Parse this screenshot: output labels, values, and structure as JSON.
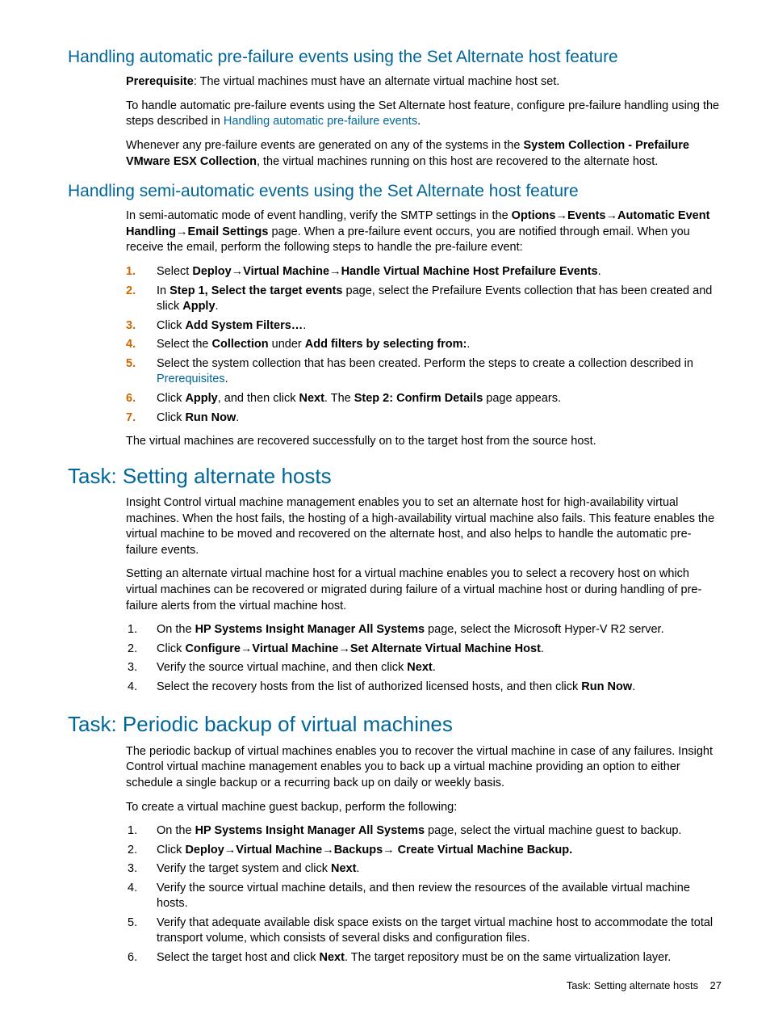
{
  "section1": {
    "heading": "Handling automatic pre-failure events using the Set Alternate host feature",
    "prereq_label": "Prerequisite",
    "prereq_text": ": The virtual machines must have an alternate virtual machine host set.",
    "p2a": "To handle automatic pre-failure events using the Set Alternate host feature, configure pre-failure handling using the steps described in ",
    "p2link": "Handling automatic pre-failure events",
    "p2b": ".",
    "p3a": "Whenever any pre-failure events are generated on any of the systems in the ",
    "p3bold": "System Collection - Prefailure VMware ESX Collection",
    "p3b": ", the virtual machines running on this host are recovered to the alternate host."
  },
  "section2": {
    "heading": "Handling semi-automatic events using the Set Alternate host feature",
    "p1a": "In semi-automatic mode of event handling, verify the SMTP settings in the ",
    "p1bold": "Options→Events→Automatic Event Handling→Email Settings",
    "p1b": " page. When a pre-failure event occurs, you are notified through email. When you receive the email, perform the following steps to handle the pre-failure event:",
    "li1a": "Select ",
    "li1bold": "Deploy→Virtual Machine→Handle Virtual Machine Host Prefailure Events",
    "li1b": ".",
    "li2a": "In ",
    "li2bold1": "Step 1, Select the target events",
    "li2b": " page, select the Prefailure Events collection that has been created and slick ",
    "li2bold2": "Apply",
    "li2c": ".",
    "li3a": "Click ",
    "li3bold": "Add System Filters…",
    "li3b": ".",
    "li4a": "Select the ",
    "li4bold1": "Collection",
    "li4b": " under ",
    "li4bold2": "Add filters by selecting from:",
    "li4c": ".",
    "li5a": "Select the system collection that has been created. Perform the steps to create a collection described in ",
    "li5link": "Prerequisites",
    "li5b": ".",
    "li6a": "Click ",
    "li6bold1": "Apply",
    "li6b": ", and then click ",
    "li6bold2": "Next",
    "li6c": ". The ",
    "li6bold3": "Step 2: Confirm Details",
    "li6d": " page appears.",
    "li7a": "Click ",
    "li7bold": "Run Now",
    "li7b": ".",
    "p_after": "The virtual machines are recovered successfully on to the target host from the source host."
  },
  "section3": {
    "heading": "Task: Setting alternate hosts",
    "p1": "Insight Control virtual machine management enables you to set an alternate host for high-availability virtual machines. When the host fails, the hosting of a high-availability virtual machine also fails. This feature enables the virtual machine to be moved and recovered on the alternate host, and also helps to handle the automatic pre-failure events.",
    "p2": "Setting an alternate virtual machine host for a virtual machine enables you to select a recovery host on which virtual machines can be recovered or migrated during failure of a virtual machine host or during handling of pre-failure alerts from the virtual machine host.",
    "li1a": "On the ",
    "li1bold": "HP Systems Insight Manager All Systems",
    "li1b": " page, select the Microsoft Hyper-V R2 server.",
    "li2a": "Click ",
    "li2bold": "Configure→Virtual Machine→Set Alternate Virtual Machine Host",
    "li2b": ".",
    "li3a": "Verify the source virtual machine, and then click ",
    "li3bold": "Next",
    "li3b": ".",
    "li4a": "Select the recovery hosts from the list of authorized licensed hosts, and then click  ",
    "li4bold": "Run Now",
    "li4b": "."
  },
  "section4": {
    "heading": "Task: Periodic backup of virtual machines",
    "p1": "The periodic backup of virtual machines enables you to recover the virtual machine in case of any failures. Insight Control virtual machine management enables you to back up a virtual machine providing an option to either schedule a single backup or a recurring back up on daily or weekly basis.",
    "p2": "To create a virtual machine guest backup, perform the following:",
    "li1a": "On the ",
    "li1bold": "HP Systems Insight Manager All Systems",
    "li1b": " page, select the virtual machine guest to backup.",
    "li2a": "Click ",
    "li2bold": "Deploy→Virtual Machine→Backups→ Create Virtual Machine Backup.",
    "li3a": "Verify the target system and click ",
    "li3bold": "Next",
    "li3b": ".",
    "li4": "Verify the source virtual machine details, and then review the resources of the available virtual machine hosts.",
    "li5": "Verify that adequate available disk space exists on the target virtual machine host to accommodate the total transport volume, which consists of several disks and configuration files.",
    "li6a": "Select the target host and click ",
    "li6bold": "Next",
    "li6b": ". The target repository must be on the same virtualization layer."
  },
  "footer": {
    "label": "Task: Setting alternate hosts",
    "pagenum": "27"
  }
}
